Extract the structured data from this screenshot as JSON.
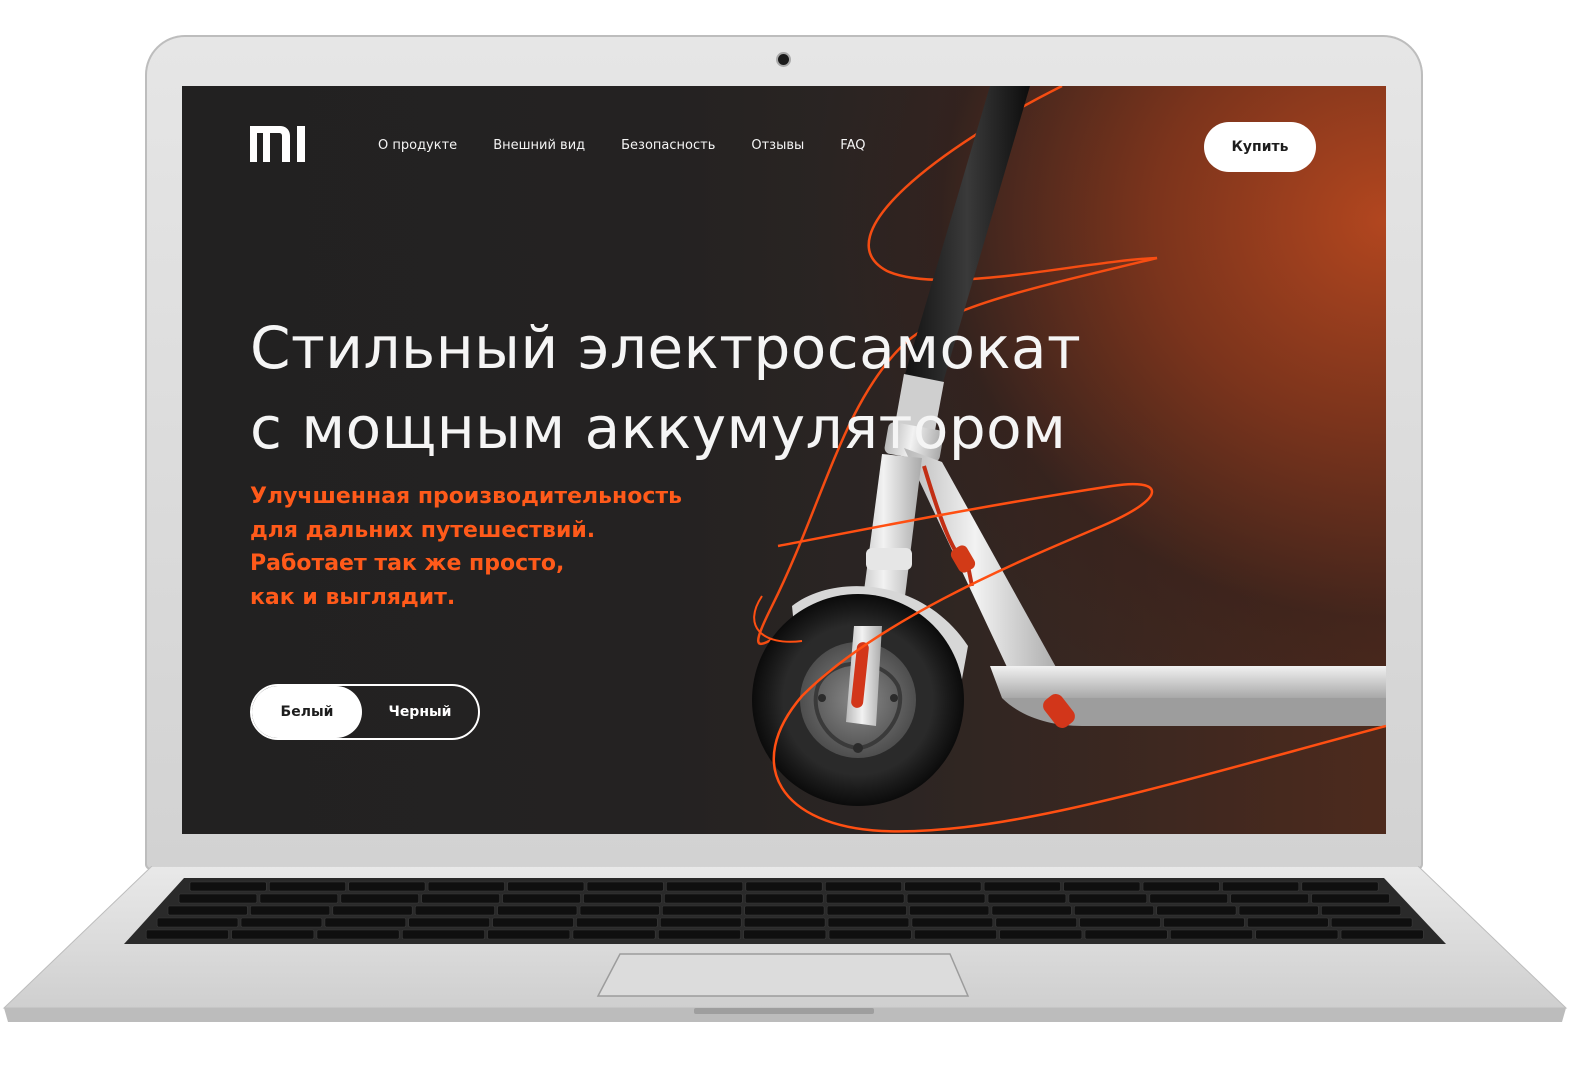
{
  "site": {
    "logo_text": "MI",
    "nav": [
      {
        "label": "О продукте"
      },
      {
        "label": "Внешний вид"
      },
      {
        "label": "Безопасность"
      },
      {
        "label": "Отзывы"
      },
      {
        "label": "FAQ"
      }
    ],
    "buy_label": "Купить"
  },
  "hero": {
    "title_lines": [
      "Стильный электросамокат",
      "с мощным аккумулятором"
    ],
    "subtitle_lines": [
      "Улучшенная производительность",
      "для дальних путешествий.",
      "Работает так же просто,",
      "как и выглядит."
    ],
    "color_options": [
      {
        "label": "Белый",
        "selected": true
      },
      {
        "label": "Черный",
        "selected": false
      }
    ]
  },
  "colors": {
    "accent": "#ff5a1a",
    "background_dark": "#232222",
    "background_warm": "#a8431e",
    "button_bg": "#ffffff"
  },
  "icons": {
    "logo": "mi-logo-icon",
    "camera": "webcam-icon"
  }
}
